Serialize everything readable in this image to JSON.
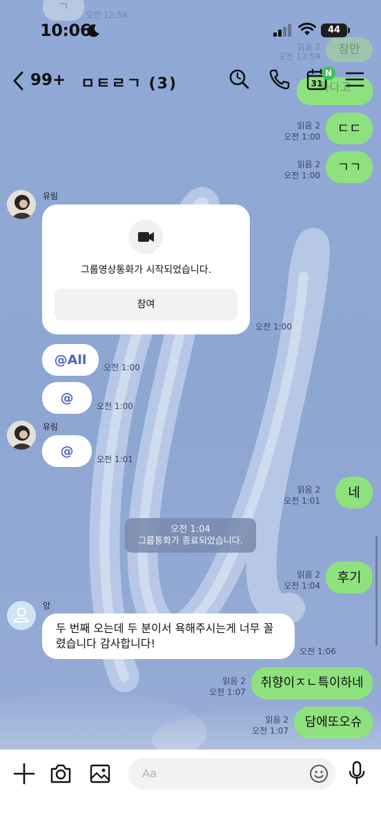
{
  "status_bar": {
    "time": "10:06",
    "battery": "44"
  },
  "header": {
    "unread_count": "99+",
    "title": "ㅁㅌㄹㄱ (3)",
    "calendar_day": "31",
    "calendar_badge": "N"
  },
  "ghost_bubbles": {
    "top_text": "ㄱ",
    "top_meta": "오전 12:58",
    "mid_meta_read": "읽음 2",
    "mid_meta_time": "오전 12:59",
    "right_text": "잠만",
    "bottom_text": "쭉다고"
  },
  "messages": [
    {
      "id": "m1",
      "side": "right",
      "text": "ㄷㄷ",
      "read": "읽음 2",
      "time": "오전 1:00"
    },
    {
      "id": "m2",
      "side": "right",
      "text": "ㄱㄱ",
      "read": "읽음 2",
      "time": "오전 1:00"
    },
    {
      "id": "m3",
      "side": "left",
      "sender": "유림",
      "type": "video_call",
      "text": "그룹영상통화가 시작되었습니다.",
      "button": "참여",
      "time": "오전 1:00"
    },
    {
      "id": "m4",
      "side": "left",
      "text": "@All",
      "time": "오전 1:00"
    },
    {
      "id": "m5",
      "side": "left",
      "text": "@",
      "time": "오전 1:00"
    },
    {
      "id": "m6",
      "side": "left",
      "sender": "유림",
      "text": "@",
      "time": "오전 1:01"
    },
    {
      "id": "m7",
      "side": "right",
      "text": "네",
      "read": "읽음 2",
      "time": "오전 1:01"
    },
    {
      "id": "sys",
      "type": "system",
      "time": "오전 1:04",
      "text": "그룹통화가 종료되었습니다."
    },
    {
      "id": "m8",
      "side": "right",
      "text": "후기",
      "read": "읽음 2",
      "time": "오전 1:04"
    },
    {
      "id": "m9",
      "side": "left",
      "sender": "앙",
      "line1": "두 번째 오는데 두 분이서 욕해주시는게 너무 꼴",
      "line2": "렸습니다 감사합니다!",
      "time": "오전 1:06"
    },
    {
      "id": "m10",
      "side": "right",
      "text": "취향이ㅈㄴ특이하네",
      "read": "읽음 2",
      "time": "오전 1:07"
    },
    {
      "id": "m11",
      "side": "right",
      "text": "담에또오슈",
      "read": "읽음 2",
      "time": "오전 1:07"
    }
  ],
  "input": {
    "placeholder": "Aa",
    "value": ""
  },
  "colors": {
    "background": "#8fa7d3",
    "my_bubble": "#8ee27e",
    "other_bubble": "#ffffff",
    "mention": "#4d64c8",
    "badge": "#3cc45a"
  },
  "icons": [
    "back-chevron-icon",
    "search-icon",
    "phone-icon",
    "calendar-icon",
    "menu-icon",
    "video-camera-icon",
    "plus-icon",
    "camera-icon",
    "image-icon",
    "emoji-icon",
    "microphone-icon",
    "moon-icon",
    "signal-icon",
    "wifi-icon",
    "battery-icon",
    "person-icon"
  ]
}
